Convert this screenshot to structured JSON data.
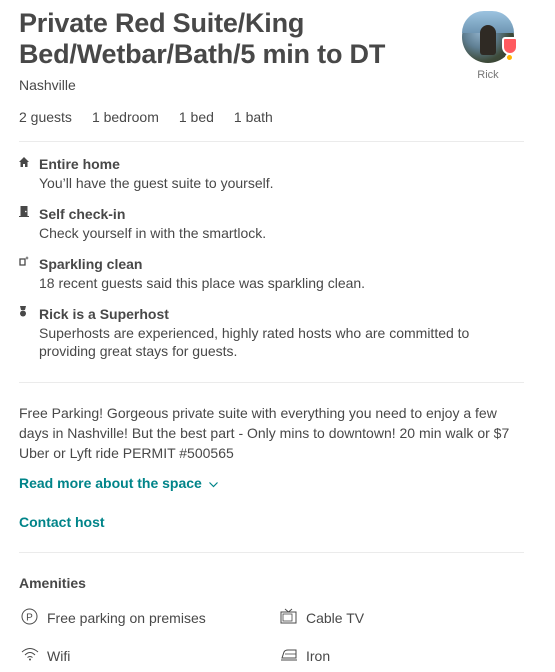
{
  "listing": {
    "title": "Private Red Suite/King Bed/Wetbar/Bath/5 min to DT",
    "city": "Nashville",
    "host_name": "Rick",
    "stats": [
      "2 guests",
      "1 bedroom",
      "1 bed",
      "1 bath"
    ]
  },
  "highlights": [
    {
      "icon": "home-icon",
      "title": "Entire home",
      "desc": "You’ll have the guest suite to yourself."
    },
    {
      "icon": "door-icon",
      "title": "Self check-in",
      "desc": "Check yourself in with the smartlock."
    },
    {
      "icon": "sparkle-icon",
      "title": "Sparkling clean",
      "desc": "18 recent guests said this place was sparkling clean."
    },
    {
      "icon": "medal-icon",
      "title": "Rick is a Superhost",
      "desc": "Superhosts are experienced, highly rated hosts who are committed to providing great stays for guests."
    }
  ],
  "description": "Free Parking! Gorgeous private suite with everything you need to enjoy a few days in Nashville! But the best part - Only mins to downtown! 20 min walk or $7 Uber or Lyft ride PERMIT #500565",
  "links": {
    "read_more": "Read more about the space",
    "contact_host": "Contact host"
  },
  "amenities": {
    "title": "Amenities",
    "items": [
      {
        "icon": "parking-icon",
        "label": "Free parking on premises"
      },
      {
        "icon": "tv-icon",
        "label": "Cable TV"
      },
      {
        "icon": "wifi-icon",
        "label": "Wifi"
      },
      {
        "icon": "iron-icon",
        "label": "Iron"
      }
    ]
  },
  "colors": {
    "text": "#484848",
    "link": "#008489",
    "divider": "#ebebeb",
    "superhost_badge": "#ff5a5f"
  }
}
